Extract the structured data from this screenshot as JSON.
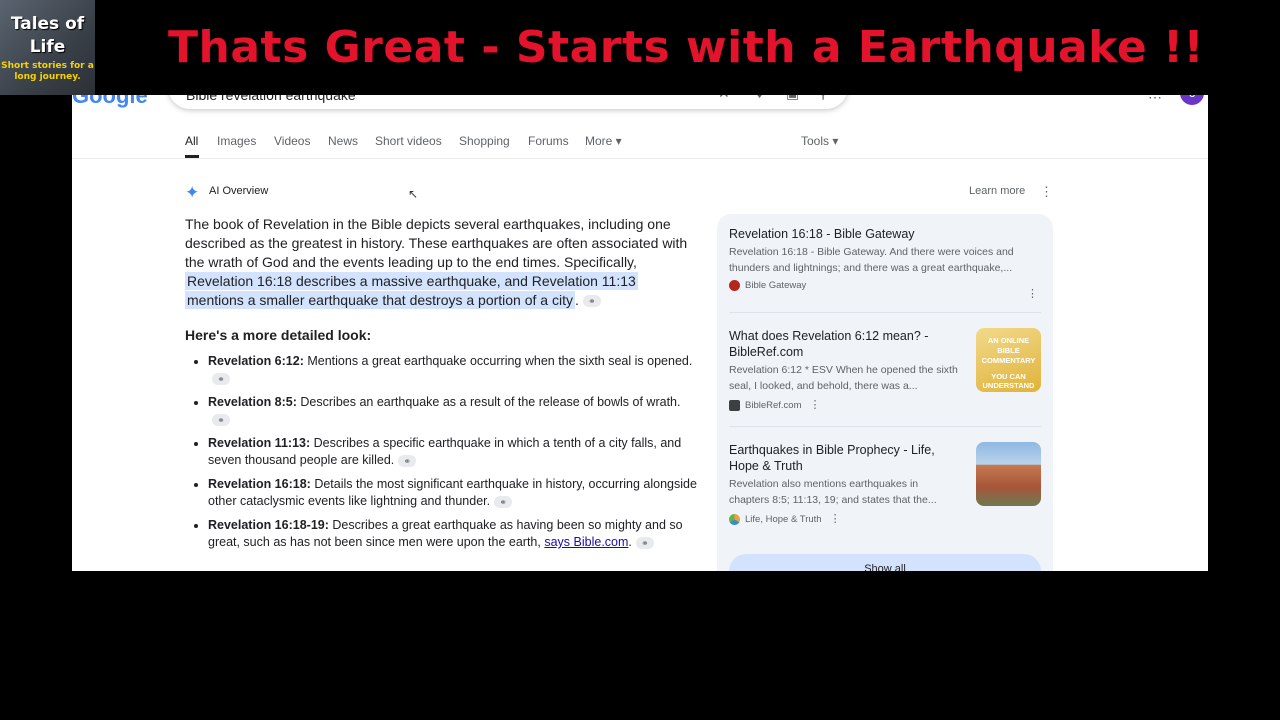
{
  "overlay": {
    "logo_title": "Tales of Life",
    "logo_subtitle": "Short stories for a long journey.",
    "headline": "Thats Great - Starts with a Earthquake !!"
  },
  "header": {
    "logo_text": "Google",
    "search_query": "Bible revelation earthquake",
    "avatar_letter": "c"
  },
  "tabs": [
    {
      "label": "All",
      "active": true
    },
    {
      "label": "Images"
    },
    {
      "label": "Videos"
    },
    {
      "label": "News"
    },
    {
      "label": "Short videos"
    },
    {
      "label": "Shopping"
    },
    {
      "label": "Forums"
    },
    {
      "label": "More ▾"
    },
    {
      "label": "Tools ▾"
    }
  ],
  "ai_overview": {
    "title": "AI Overview",
    "learn_more": "Learn more",
    "intro": "The book of Revelation in the Bible depicts several earthquakes, including one described as the greatest in history. These earthquakes are often associated with the wrath of God and the events leading up to the end times. Specifically,",
    "intro_highlight": "Revelation 16:18 describes a massive earthquake, and Revelation 11:13 mentions a smaller earthquake that destroys a portion of a city",
    "detail_heading": "Here's a more detailed look:",
    "bullets": [
      {
        "ref": "Revelation 6:12:",
        "text": "Mentions a great earthquake occurring when the sixth seal is opened."
      },
      {
        "ref": "Revelation 8:5:",
        "text": "Describes an earthquake as a result of the release of bowls of wrath."
      },
      {
        "ref": "Revelation 11:13:",
        "text": "Describes a specific earthquake in which a tenth of a city falls, and seven thousand people are killed."
      },
      {
        "ref": "Revelation 16:18:",
        "text": "Details the most significant earthquake in history, occurring alongside other cataclysmic events like lightning and thunder."
      },
      {
        "ref": "Revelation 16:18-19:",
        "text": "Describes a great earthquake as having been so mighty and so great, such as has not been since men were upon the earth,",
        "link": "says Bible.com"
      }
    ]
  },
  "sources": {
    "items": [
      {
        "title": "Revelation 16:18 - Bible Gateway",
        "snippet": "Revelation 16:18 - Bible Gateway. And there were voices and thunders and lightnings; and there was a great earthquake,...",
        "site": "Bible Gateway",
        "fav_color": "#b3261e"
      },
      {
        "title": "What does Revelation 6:12 mean? - BibleRef.com",
        "snippet": "Revelation 6:12 * ESV When he opened the sixth seal, I looked, and behold, there was a...",
        "site": "BibleRef.com",
        "fav_color": "#3c4043",
        "thumb_text": "AN ONLINE BIBLE COMMENTARY",
        "thumb_text2": "YOU CAN UNDERSTAND"
      },
      {
        "title": "Earthquakes in Bible Prophecy - Life, Hope & Truth",
        "snippet": "Revelation also mentions earthquakes in chapters 8:5; 11:13, 19; and states that the...",
        "site": "Life, Hope & Truth",
        "fav_color": "#e8a33b"
      }
    ],
    "show_all": "Show all"
  }
}
